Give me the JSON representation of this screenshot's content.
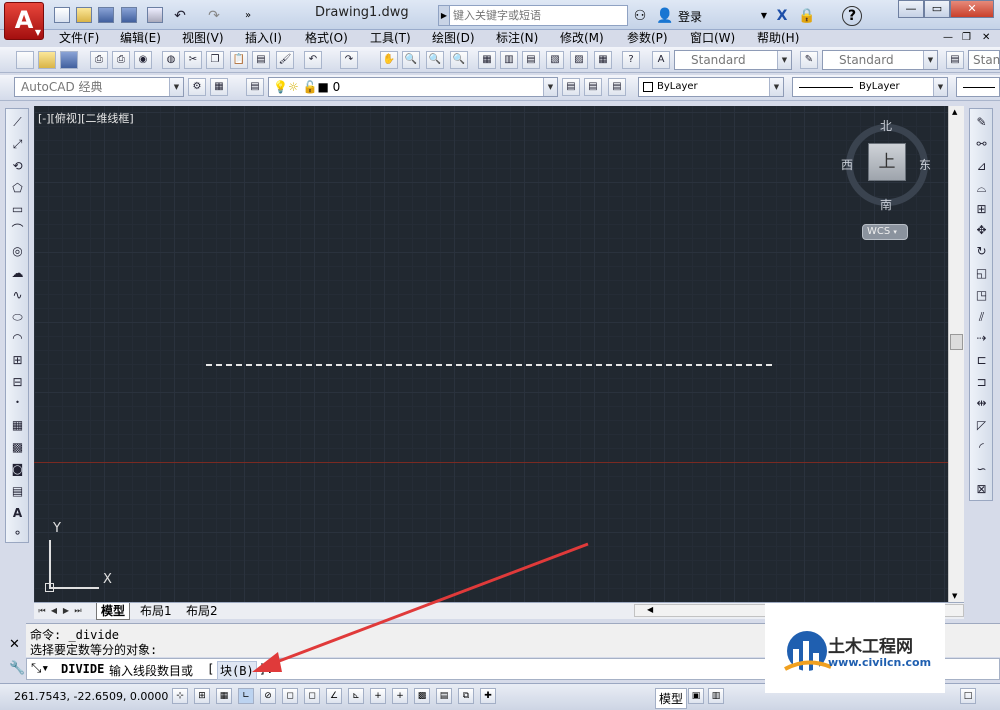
{
  "titlebar": {
    "app_letter": "A",
    "document_title": "Drawing1.dwg",
    "search_placeholder": "键入关键字或短语",
    "login_label": "登录",
    "help_label": "?"
  },
  "menus": [
    "文件(F)",
    "编辑(E)",
    "视图(V)",
    "插入(I)",
    "格式(O)",
    "工具(T)",
    "绘图(D)",
    "标注(N)",
    "修改(M)",
    "参数(P)",
    "窗口(W)",
    "帮助(H)"
  ],
  "toolbar1": {
    "text_style": "Standard",
    "dim_style": "Standard",
    "table_style": "Stan"
  },
  "toolbar2": {
    "workspace": "AutoCAD 经典",
    "layer": "0",
    "color": "ByLayer",
    "linetype": "ByLayer"
  },
  "viewport": {
    "label": "[-][俯视][二维线框]",
    "viewcube": {
      "north": "北",
      "south": "南",
      "east": "东",
      "west": "西",
      "top": "上",
      "coord": "WCS"
    },
    "ucs_x": "X",
    "ucs_y": "Y"
  },
  "tabs": [
    "模型",
    "布局1",
    "布局2"
  ],
  "command": {
    "history": [
      "命令: _divide",
      "选择要定数等分的对象:"
    ],
    "prompt_cmd": "DIVIDE",
    "prompt_text": "输入线段数目或",
    "prompt_bracket_open": "[",
    "prompt_option": "块(B)",
    "prompt_bracket_close": "]:"
  },
  "status": {
    "coords": "261.7543, -22.6509, 0.0000",
    "model_label": "模型"
  },
  "watermark": {
    "title": "土木工程网",
    "url": "www.civilcn.com"
  },
  "colors": {
    "canvas_bg": "#212830",
    "app_red": "#c81e1e",
    "arrow_red": "#e03a3a"
  }
}
